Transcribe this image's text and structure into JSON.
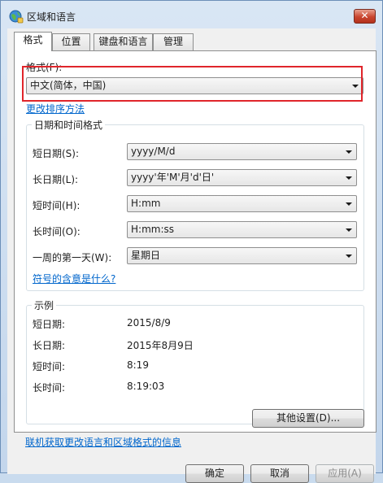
{
  "window": {
    "title": "区域和语言",
    "close_label": "✕"
  },
  "tabs": [
    {
      "label": "格式"
    },
    {
      "label": "位置"
    },
    {
      "label": "键盘和语言"
    },
    {
      "label": "管理"
    }
  ],
  "format": {
    "label": "格式(F):",
    "value": "中文(简体，中国)",
    "sort_link": "更改排序方法"
  },
  "datetime": {
    "group_title": "日期和时间格式",
    "rows": [
      {
        "label": "短日期(S):",
        "value": "yyyy/M/d"
      },
      {
        "label": "长日期(L):",
        "value": "yyyy'年'M'月'd'日'"
      },
      {
        "label": "短时间(H):",
        "value": "H:mm"
      },
      {
        "label": "长时间(O):",
        "value": "H:mm:ss"
      },
      {
        "label": "一周的第一天(W):",
        "value": "星期日"
      }
    ],
    "notation_link": "符号的含意是什么?"
  },
  "examples": {
    "group_title": "示例",
    "rows": [
      {
        "label": "短日期:",
        "value": "2015/8/9"
      },
      {
        "label": "长日期:",
        "value": "2015年8月9日"
      },
      {
        "label": "短时间:",
        "value": "8:19"
      },
      {
        "label": "长时间:",
        "value": "8:19:03"
      }
    ]
  },
  "other_settings_button": "其他设置(D)...",
  "online_link": "联机获取更改语言和区域格式的信息",
  "footer": {
    "ok": "确定",
    "cancel": "取消",
    "apply": "应用(A)"
  },
  "colors": {
    "link": "#0066cc",
    "highlight_box": "#e0252b",
    "close_button": "#c9452f"
  }
}
